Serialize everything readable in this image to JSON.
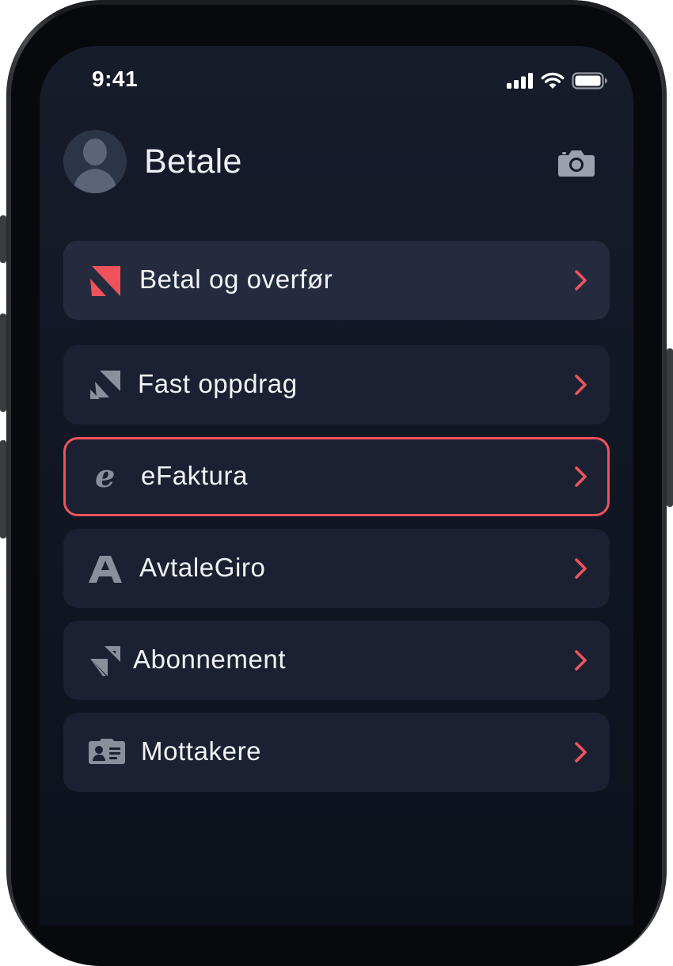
{
  "status_bar": {
    "time": "9:41"
  },
  "header": {
    "title": "Betale",
    "avatar_icon": "user-avatar-icon",
    "camera_icon": "camera-icon"
  },
  "menu": {
    "items": [
      {
        "label": "Betal og overfør",
        "icon": "pay-transfer-icon",
        "state": "primary"
      },
      {
        "label": "Fast oppdrag",
        "icon": "standing-order-icon",
        "state": "default"
      },
      {
        "label": "eFaktura",
        "icon": "efaktura-icon",
        "state": "focused"
      },
      {
        "label": "AvtaleGiro",
        "icon": "avtalegiro-icon",
        "state": "default"
      },
      {
        "label": "Abonnement",
        "icon": "subscription-icon",
        "state": "default"
      },
      {
        "label": "Mottakere",
        "icon": "recipients-card-icon",
        "state": "default"
      }
    ]
  },
  "colors": {
    "accent": "#f0525c",
    "screen_background": "#131827",
    "card_background": "#1b2132",
    "primary_card_background": "#252b3f",
    "text": "#f2f3f7",
    "icon_grey": "#8a8f9c"
  }
}
